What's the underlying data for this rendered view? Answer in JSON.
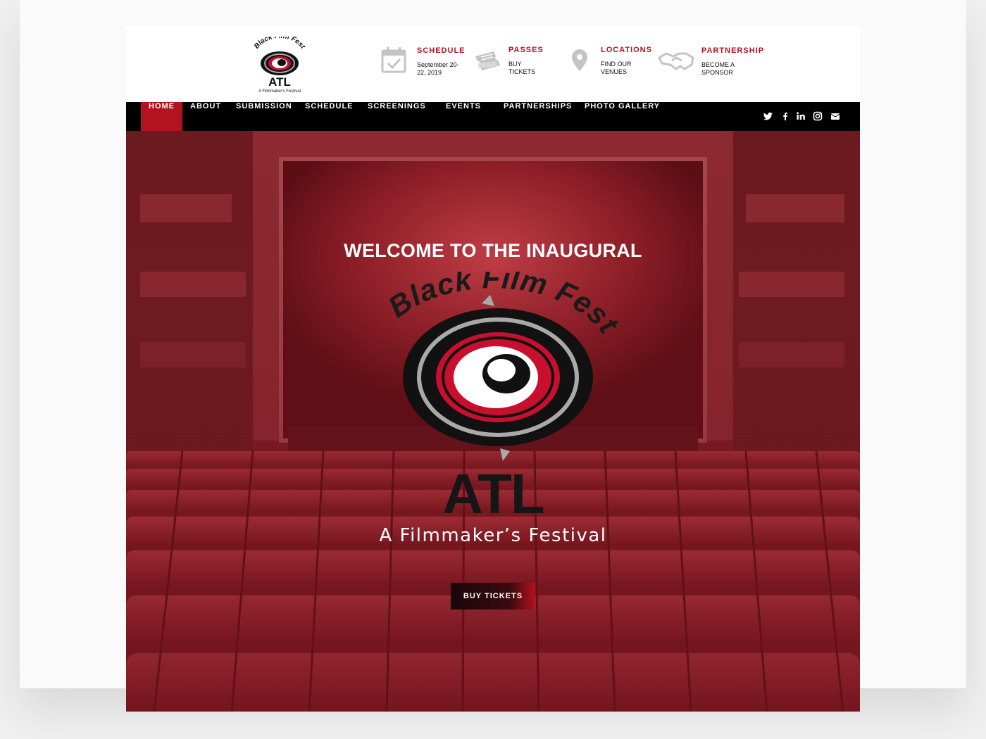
{
  "brand": {
    "logo_arc_text": "Black Film Fest",
    "logo_city": "ATL",
    "logo_tagline": "A Filmmaker's Festival"
  },
  "header_info": [
    {
      "icon": "calendar-icon",
      "title": "SCHEDULE",
      "sub": "September 20-\n22, 2019"
    },
    {
      "icon": "ticket-icon",
      "title": "PASSES",
      "sub": "BUY\nTICKETS"
    },
    {
      "icon": "map-pin-icon",
      "title": "LOCATIONS",
      "sub": "FIND OUR\nVENUES"
    },
    {
      "icon": "handshake-icon",
      "title": "PARTNERSHIP",
      "sub": "BECOME A\nSPONSOR"
    }
  ],
  "nav": {
    "items": [
      "HOME",
      "ABOUT",
      "SUBMISSION",
      "SCHEDULE",
      "SCREENINGS",
      "EVENTS",
      "PARTNERSHIPS",
      "PHOTO GALLERY"
    ],
    "active": "HOME",
    "social": [
      "twitter-icon",
      "facebook-icon",
      "linkedin-icon",
      "instagram-icon",
      "email-icon"
    ]
  },
  "hero": {
    "heading": "WELCOME TO THE INAUGURAL",
    "logo_arc_text": "Black Film Fest",
    "logo_city": "ATL",
    "tagline": "A Filmmaker’s Festival",
    "cta_label": "BUY TICKETS"
  },
  "colors": {
    "accent": "#b3121f",
    "nav_bg": "#000000",
    "icon_gray": "#c4c4c4"
  }
}
